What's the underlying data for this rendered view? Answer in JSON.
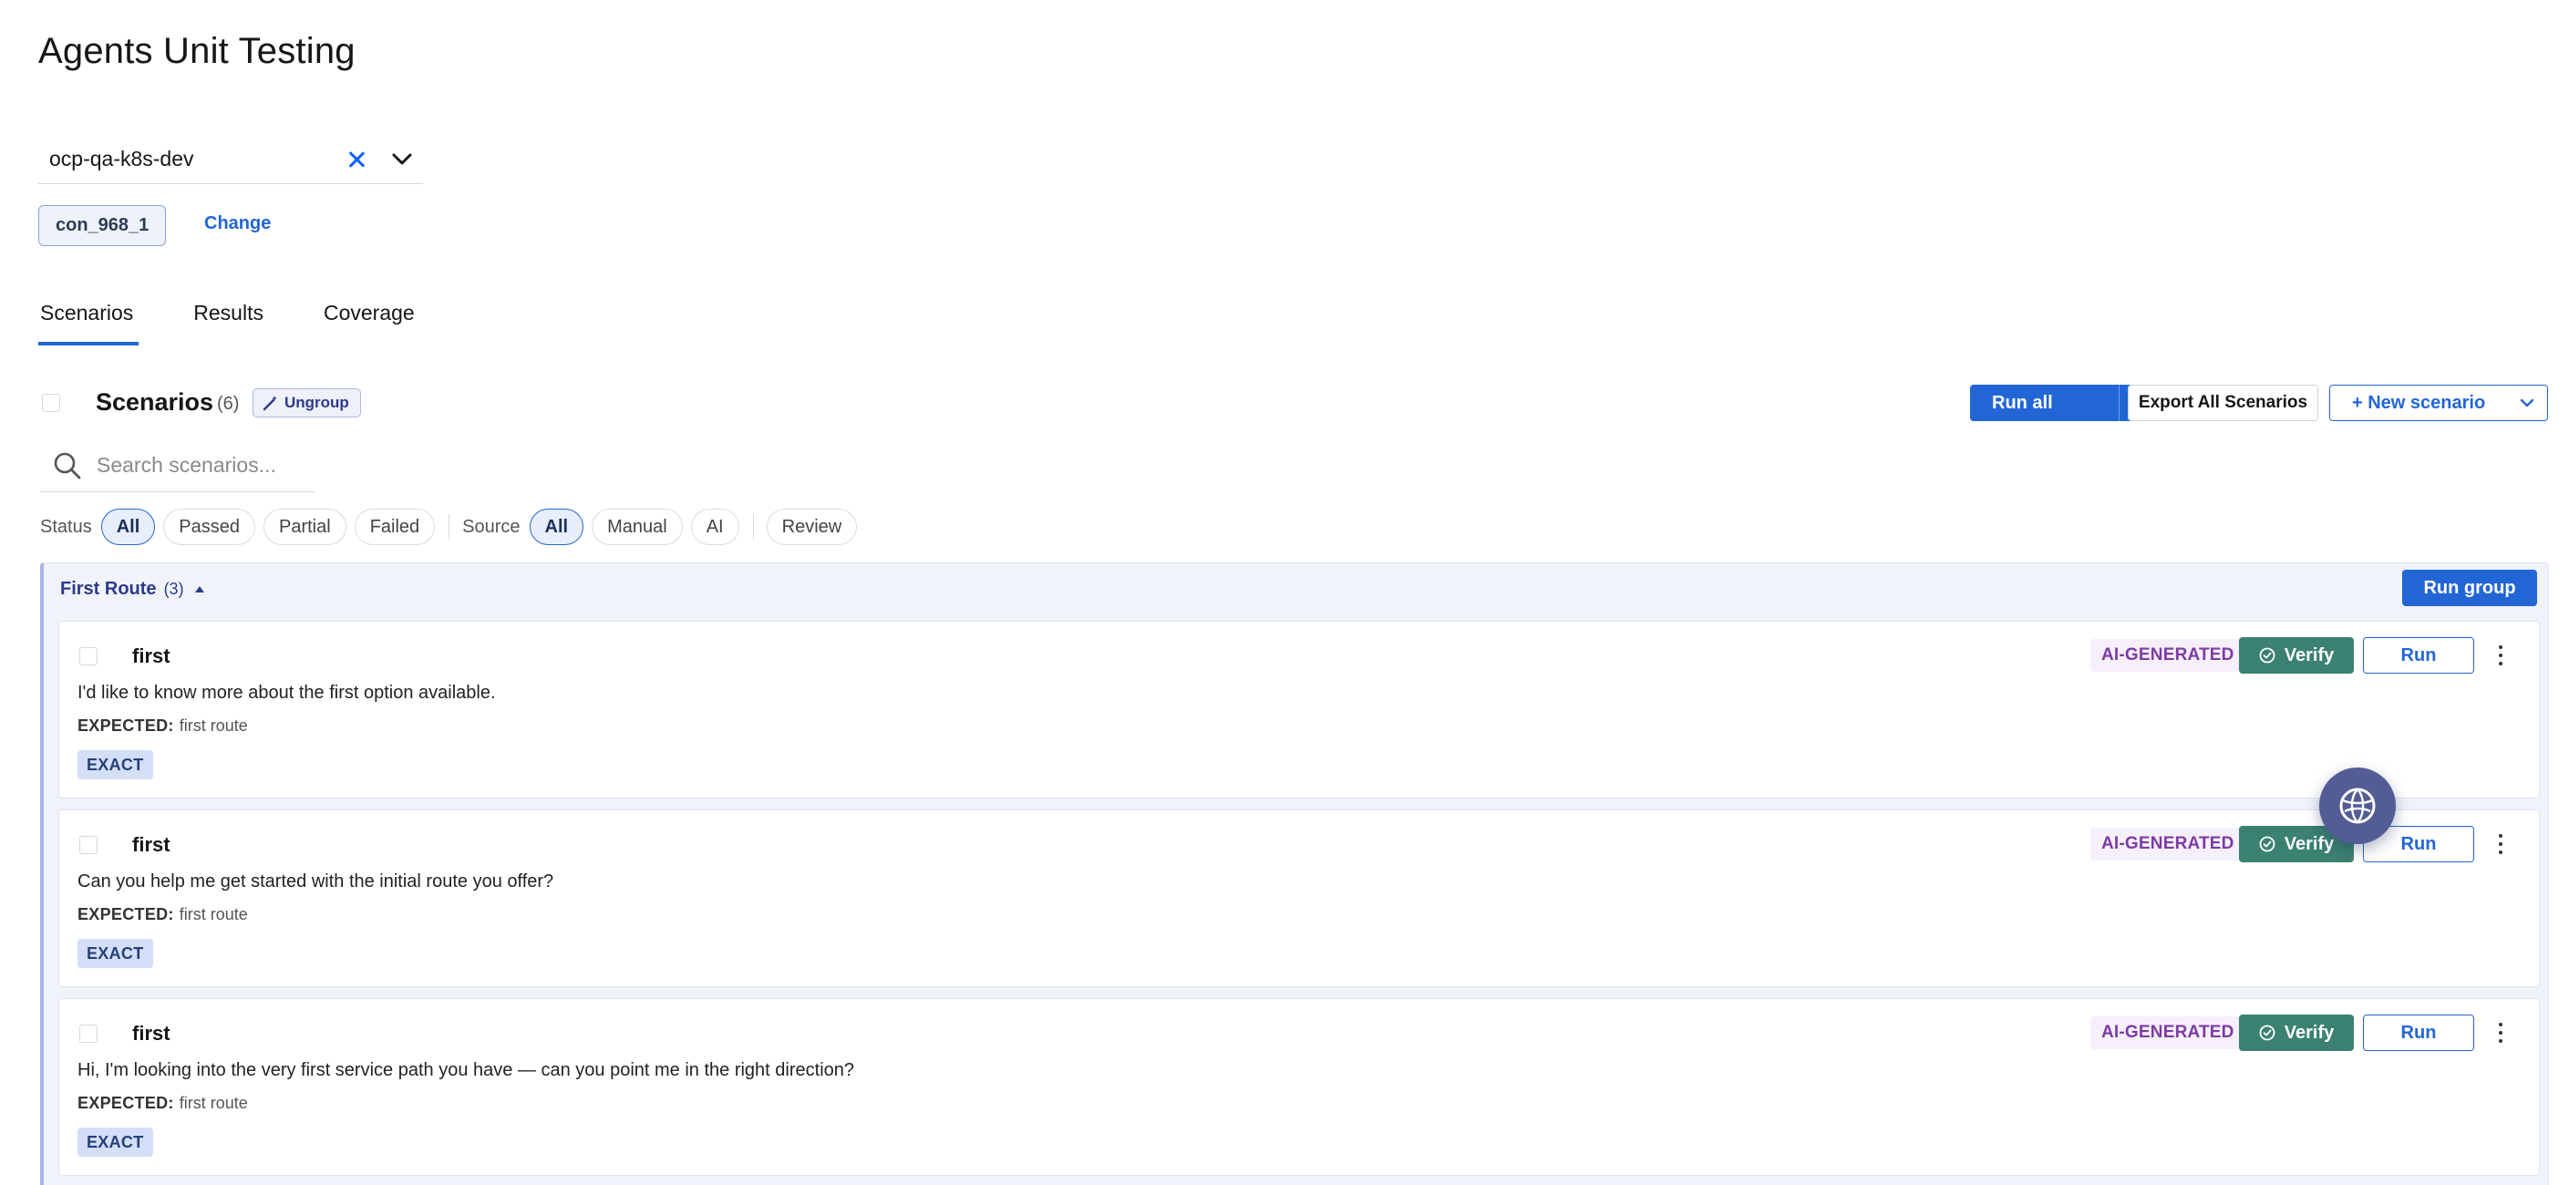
{
  "page": {
    "title": "Agents Unit Testing"
  },
  "environment": {
    "value": "ocp-qa-k8s-dev"
  },
  "connection": {
    "tag": "con_968_1",
    "change_label": "Change"
  },
  "tabs": [
    {
      "label": "Scenarios",
      "active": true
    },
    {
      "label": "Results",
      "active": false
    },
    {
      "label": "Coverage",
      "active": false
    }
  ],
  "scenarios_header": {
    "title": "Scenarios",
    "count": "(6)",
    "ungroup_label": "Ungroup",
    "run_all_label": "Run all",
    "export_label": "Export All Scenarios",
    "new_scenario_label": "+ New scenario"
  },
  "search": {
    "placeholder": "Search scenarios..."
  },
  "filters": {
    "status_label": "Status",
    "status_options": [
      "All",
      "Passed",
      "Partial",
      "Failed"
    ],
    "status_selected": "All",
    "source_label": "Source",
    "source_options": [
      "All",
      "Manual",
      "AI"
    ],
    "source_selected": "All",
    "review_label": "Review"
  },
  "group": {
    "title": "First Route",
    "count": "(3)",
    "run_group_label": "Run group",
    "scenarios": [
      {
        "title": "first",
        "text": "I'd like to know more about the first option available.",
        "expected_label": "EXPECTED:",
        "expected_value": "first route",
        "match": "EXACT",
        "source_badge": "AI-GENERATED",
        "verify_label": "Verify",
        "run_label": "Run"
      },
      {
        "title": "first",
        "text": "Can you help me get started with the initial route you offer?",
        "expected_label": "EXPECTED:",
        "expected_value": "first route",
        "match": "EXACT",
        "source_badge": "AI-GENERATED",
        "verify_label": "Verify",
        "run_label": "Run"
      },
      {
        "title": "first",
        "text": "Hi, I'm looking into the very first service path you have — can you point me in the right direction?",
        "expected_label": "EXPECTED:",
        "expected_value": "first route",
        "match": "EXACT",
        "source_badge": "AI-GENERATED",
        "verify_label": "Verify",
        "run_label": "Run"
      }
    ]
  },
  "colors": {
    "primary": "#2266d6",
    "verify": "#3b8171",
    "ai_badge": "#7d3aa4",
    "fab": "#535c95"
  },
  "icons": {
    "clear": "close-icon",
    "dropdown": "chevron-down-icon",
    "search": "search-icon",
    "ungroup": "magic-wand-icon",
    "verify": "check-circle-icon",
    "more": "kebab-menu-icon",
    "assistant": "assistant-globe-icon"
  }
}
